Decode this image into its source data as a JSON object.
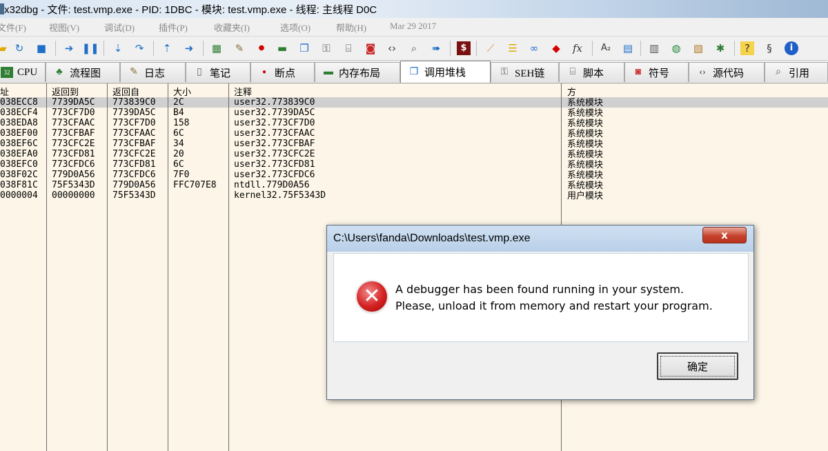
{
  "window": {
    "title": "x32dbg - 文件: test.vmp.exe - PID: 1DBC - 模块: test.vmp.exe - 线程: 主线程 D0C"
  },
  "menubar": {
    "items": [
      "文件(F)",
      "视图(V)",
      "调试(D)",
      "插件(P)",
      "收藏夹(I)",
      "选项(O)",
      "帮助(H)",
      "Mar 29 2017"
    ]
  },
  "toolbar": {
    "icons": [
      "open-icon",
      "restart-icon",
      "stop-icon",
      "run-icon",
      "pause-icon",
      "step-into-icon",
      "step-over-icon",
      "execute-till-return-icon",
      "run-to-user-code-icon",
      "cpu-chip-icon",
      "script-icon",
      "breakpoint-icon",
      "memory-icon",
      "windows-icon",
      "handles-icon",
      "source-icon",
      "references-icon",
      "tags-icon",
      "search-icon",
      "trace-icon",
      "patch-icon",
      "bandage-icon",
      "comments-icon",
      "links-icon",
      "labels-icon",
      "functions-icon",
      "font-icon",
      "calculator-icon",
      "globe-icon",
      "book-icon",
      "bug-icon",
      "help-icon",
      "donate-icon",
      "info-icon"
    ]
  },
  "tabs": [
    {
      "label": "CPU",
      "icon": "cpu-icon"
    },
    {
      "label": "流程图",
      "icon": "tree-icon"
    },
    {
      "label": "日志",
      "icon": "log-icon"
    },
    {
      "label": "笔记",
      "icon": "notes-icon"
    },
    {
      "label": "断点",
      "icon": "breakpoint-dot-icon"
    },
    {
      "label": "内存布局",
      "icon": "memory-map-icon"
    },
    {
      "label": "调用堆栈",
      "icon": "callstack-icon"
    },
    {
      "label": "SEH链",
      "icon": "seh-icon"
    },
    {
      "label": "脚本",
      "icon": "script-tab-icon"
    },
    {
      "label": "符号",
      "icon": "symbols-icon"
    },
    {
      "label": "源代码",
      "icon": "source-code-icon"
    },
    {
      "label": "引用",
      "icon": "references-tab-icon"
    }
  ],
  "active_tab": "调用堆栈",
  "callstack": {
    "columns": [
      "址",
      "返回到",
      "返回自",
      "大小",
      "注释",
      "方"
    ],
    "rows": [
      {
        "addr": "038ECC8",
        "ret_to": "7739DA5C",
        "ret_from": "773839C0",
        "size": "2C",
        "comment": "user32.773839C0",
        "party": "系统模块"
      },
      {
        "addr": "038ECF4",
        "ret_to": "773CF7D0",
        "ret_from": "7739DA5C",
        "size": "B4",
        "comment": "user32.7739DA5C",
        "party": "系统模块"
      },
      {
        "addr": "038EDA8",
        "ret_to": "773CFAAC",
        "ret_from": "773CF7D0",
        "size": "158",
        "comment": "user32.773CF7D0",
        "party": "系统模块"
      },
      {
        "addr": "038EF00",
        "ret_to": "773CFBAF",
        "ret_from": "773CFAAC",
        "size": "6C",
        "comment": "user32.773CFAAC",
        "party": "系统模块"
      },
      {
        "addr": "038EF6C",
        "ret_to": "773CFC2E",
        "ret_from": "773CFBAF",
        "size": "34",
        "comment": "user32.773CFBAF",
        "party": "系统模块"
      },
      {
        "addr": "038EFA0",
        "ret_to": "773CFD81",
        "ret_from": "773CFC2E",
        "size": "20",
        "comment": "user32.773CFC2E",
        "party": "系统模块"
      },
      {
        "addr": "038EFC0",
        "ret_to": "773CFDC6",
        "ret_from": "773CFD81",
        "size": "6C",
        "comment": "user32.773CFD81",
        "party": "系统模块"
      },
      {
        "addr": "038F02C",
        "ret_to": "779D0A56",
        "ret_from": "773CFDC6",
        "size": "7F0",
        "comment": "user32.773CFDC6",
        "party": "系统模块"
      },
      {
        "addr": "038F81C",
        "ret_to": "75F5343D",
        "ret_from": "779D0A56",
        "size": "FFC707E8",
        "comment": "ntdll.779D0A56",
        "party": "系统模块"
      },
      {
        "addr": "0000004",
        "ret_to": "00000000",
        "ret_from": "75F5343D",
        "size": "",
        "comment": "kernel32.75F5343D",
        "party": "用户模块"
      }
    ]
  },
  "dialog": {
    "title": "C:\\Users\\fanda\\Downloads\\test.vmp.exe",
    "close_label": "x",
    "message_line1": "A debugger has been found running in your system.",
    "message_line2": "Please, unload it from memory and restart your program.",
    "ok_label": "确定",
    "error_icon": "error-x-icon"
  }
}
